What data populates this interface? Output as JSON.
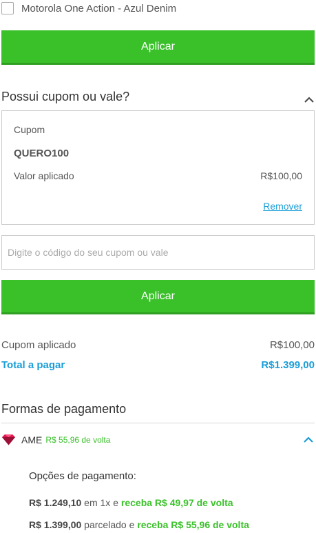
{
  "product": {
    "label": "Motorola One Action - Azul Denim"
  },
  "apply_button_1": {
    "label": "Aplicar"
  },
  "coupon_section": {
    "title": "Possui cupom ou vale?",
    "coupon_label": "Cupom",
    "coupon_code": "QUERO100",
    "applied_label": "Valor aplicado",
    "applied_value": "R$100,00",
    "remove_label": "Remover"
  },
  "coupon_input": {
    "placeholder": "Digite o código do seu cupom ou vale"
  },
  "apply_button_2": {
    "label": "Aplicar"
  },
  "summary": {
    "coupon_applied_label": "Cupom aplicado",
    "coupon_applied_value": "R$100,00",
    "total_label": "Total a pagar",
    "total_value": "R$1.399,00"
  },
  "payment": {
    "title": "Formas de pagamento",
    "ame_label": "AME",
    "ame_cashback": "R$ 55,96 de volta",
    "options_title": "Opções de pagamento:",
    "option1": {
      "amount": "R$ 1.249,10",
      "mid": " em 1x e ",
      "cashback": "receba R$ 49,97 de volta"
    },
    "option2": {
      "amount": "R$ 1.399,00",
      "mid": " parcelado e ",
      "cashback": "receba R$ 55,96 de volta"
    }
  },
  "colors": {
    "green": "#3ac12a",
    "blue": "#1a9ed8",
    "ame_pink": "#e0164f"
  }
}
